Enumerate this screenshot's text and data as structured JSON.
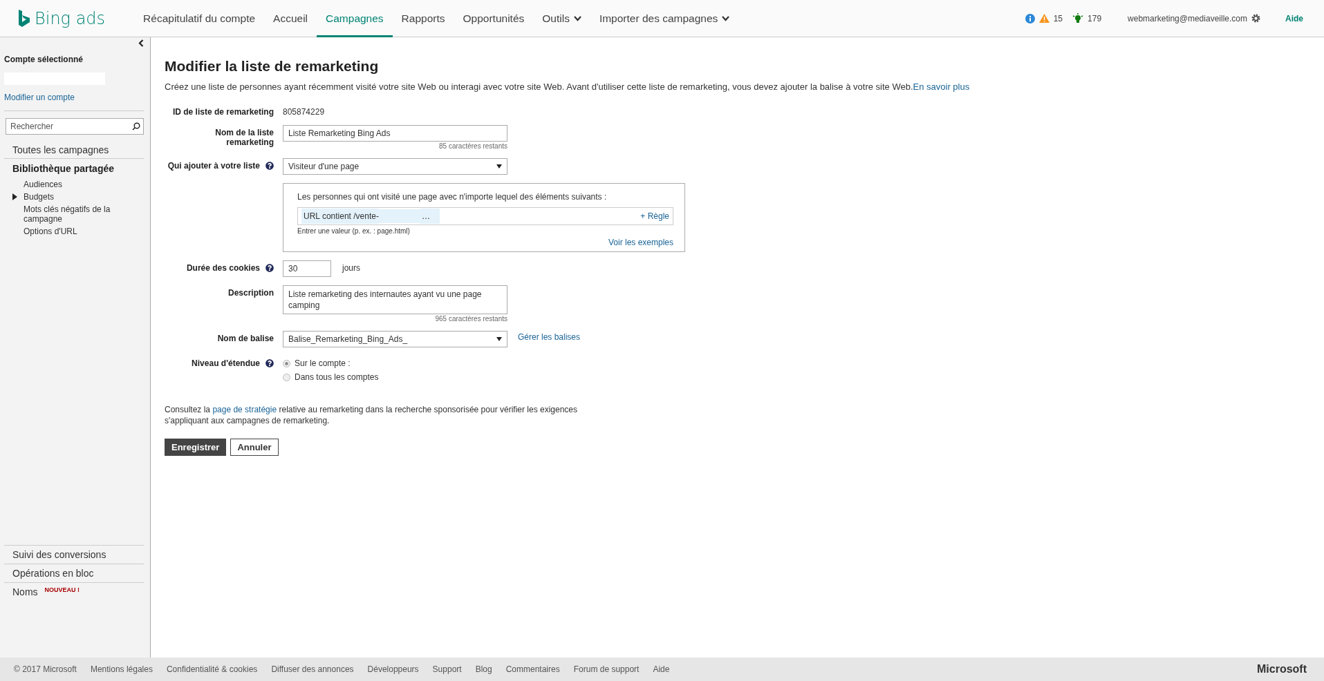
{
  "header": {
    "logo": "Bing ads",
    "nav": [
      {
        "label": "Récapitulatif du compte",
        "selected": false,
        "kind": "link"
      },
      {
        "label": "Accueil",
        "selected": false,
        "kind": "link"
      },
      {
        "label": "Campagnes",
        "selected": true,
        "kind": "link"
      },
      {
        "label": "Rapports",
        "selected": false,
        "kind": "link"
      },
      {
        "label": "Opportunités",
        "selected": false,
        "kind": "link"
      },
      {
        "label": "Outils",
        "selected": false,
        "kind": "dropdown"
      },
      {
        "label": "Importer des campagnes",
        "selected": false,
        "kind": "dropdown"
      }
    ],
    "alerts_count": "15",
    "opportunities_count": "179",
    "user": "webmarketing@mediaveille.com",
    "help": "Aide"
  },
  "sidebar": {
    "account_title": "Compte sélectionné",
    "change_account": "Modifier un compte",
    "search": {
      "placeholder": "Rechercher"
    },
    "all_campaigns": "Toutes les campagnes",
    "library_title": "Bibliothèque partagée",
    "library_items": [
      {
        "label": "Audiences",
        "marker": false
      },
      {
        "label": "Budgets",
        "marker": true
      },
      {
        "label": "Mots clés négatifs de la campagne",
        "marker": false
      },
      {
        "label": "Options d'URL",
        "marker": false
      }
    ],
    "bottom_items": [
      {
        "label": "Suivi des conversions"
      },
      {
        "label": "Opérations en bloc"
      },
      {
        "label": "Noms",
        "badge": "NOUVEAU !"
      }
    ]
  },
  "form": {
    "title": "Modifier la liste de remarketing",
    "intro": "Créez une liste de personnes ayant récemment visité votre site Web ou interagi avec votre site Web. Avant d'utiliser cette liste de remarketing, vous devez ajouter la balise à votre site Web.",
    "intro_link": "En savoir plus",
    "id_label": "ID de liste de remarketing",
    "id_value": "805874229",
    "name_label": "Nom de la liste remarketing",
    "name_value": "Liste Remarketing Bing Ads",
    "name_remaining": "85 caractères restants",
    "who_label": "Qui ajouter à votre liste",
    "who_value": "Visiteur d'une page",
    "rule_intro": "Les personnes qui ont visité une page avec n'importe lequel des éléments suivants :",
    "rule_value": "URL contient /vente-",
    "rule_ellipsis": "…",
    "add_rule": "+ Règle",
    "rule_hint": "Entrer une valeur (p. ex. : page.html)",
    "examples": "Voir les exemples",
    "cookie_label": "Durée des cookies",
    "cookie_value": "30",
    "cookie_unit": "jours",
    "desc_label": "Description",
    "desc_value": "Liste remarketing des internautes ayant vu une page camping",
    "desc_remaining": "965 caractères restants",
    "tag_label": "Nom de balise",
    "tag_value": "Balise_Remarketing_Bing_Ads_",
    "manage_tags": "Gérer les balises",
    "scope_label": "Niveau d'étendue",
    "scope_options": [
      {
        "label": "Sur le compte :",
        "selected": true
      },
      {
        "label": "Dans tous les comptes",
        "selected": false
      }
    ],
    "policy_before": "Consultez la ",
    "policy_link": "page de stratégie",
    "policy_after": " relative au remarketing dans la recherche sponsorisée pour vérifier les exigences s'appliquant aux campagnes de remarketing.",
    "save": "Enregistrer",
    "cancel": "Annuler"
  },
  "footer": {
    "links": [
      "© 2017 Microsoft",
      "Mentions légales",
      "Confidentialité & cookies",
      "Diffuser des annonces",
      "Développeurs",
      "Support",
      "Blog",
      "Commentaires",
      "Forum de support",
      "Aide"
    ],
    "brand": "Microsoft"
  }
}
